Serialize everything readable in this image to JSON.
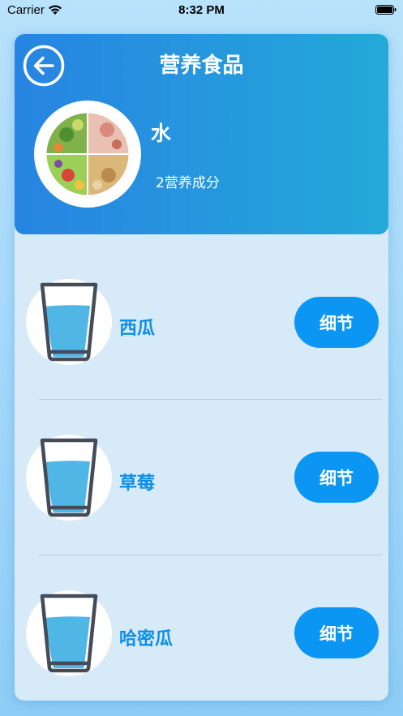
{
  "status_bar": {
    "carrier": "Carrier",
    "time": "8:32 PM"
  },
  "header": {
    "title": "营养食品",
    "back_icon": "arrow-left-circle-icon",
    "food_name": "水",
    "nutrient_count": "2营养成分",
    "gradient_start": "#2784e2",
    "gradient_end": "#24a9d9"
  },
  "items": [
    {
      "name": "西瓜",
      "icon": "water-glass-icon",
      "button_label": "细节"
    },
    {
      "name": "草莓",
      "icon": "water-glass-icon",
      "button_label": "细节"
    },
    {
      "name": "哈密瓜",
      "icon": "water-glass-icon",
      "button_label": "细节"
    }
  ],
  "colors": {
    "accent": "#0b96f4",
    "item_text": "#0d8ee8",
    "panel_bg": "#d6eaf8"
  }
}
